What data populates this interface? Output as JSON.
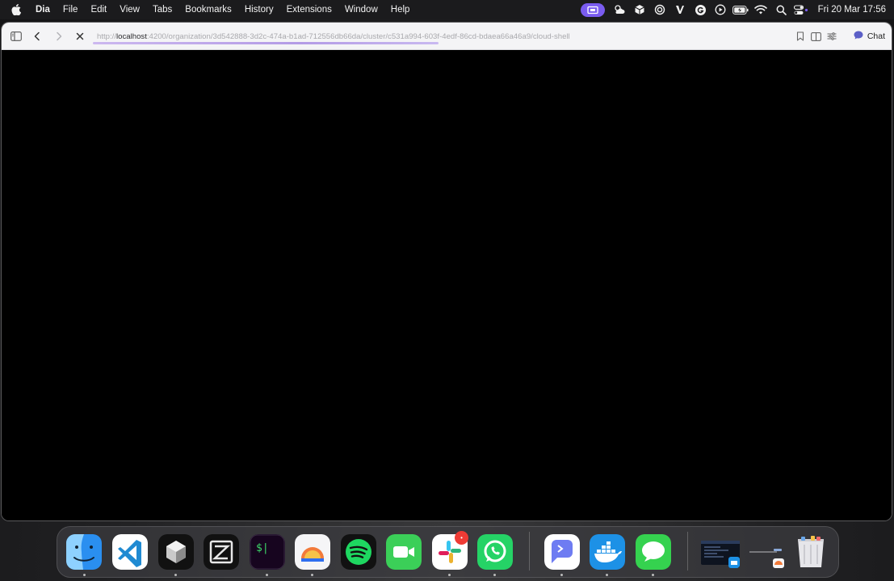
{
  "menubar": {
    "app_name": "Dia",
    "menus": [
      "File",
      "Edit",
      "View",
      "Tabs",
      "Bookmarks",
      "History",
      "Extensions",
      "Window",
      "Help"
    ],
    "clock": "Fri 20 Mar  17:56"
  },
  "browser": {
    "url_scheme": "http://",
    "url_host": "localhost",
    "url_path": ":4200/organization/3d542888-3d2c-474a-b1ad-712556db66da/cluster/c531a994-603f-4edf-86cd-bdaea66a46a9/cloud-shell",
    "chat_label": "Chat",
    "load_progress": 0.49
  },
  "dock": {
    "apps": [
      "finder",
      "vscode",
      "cube-app",
      "zed",
      "terminal",
      "arc",
      "spotify",
      "facetime",
      "slack",
      "whatsapp",
      "raycast",
      "docker",
      "messages"
    ],
    "slack_badge": "•"
  },
  "colors": {
    "accent_purple": "#7a5cf0",
    "page_background": "#000000"
  }
}
